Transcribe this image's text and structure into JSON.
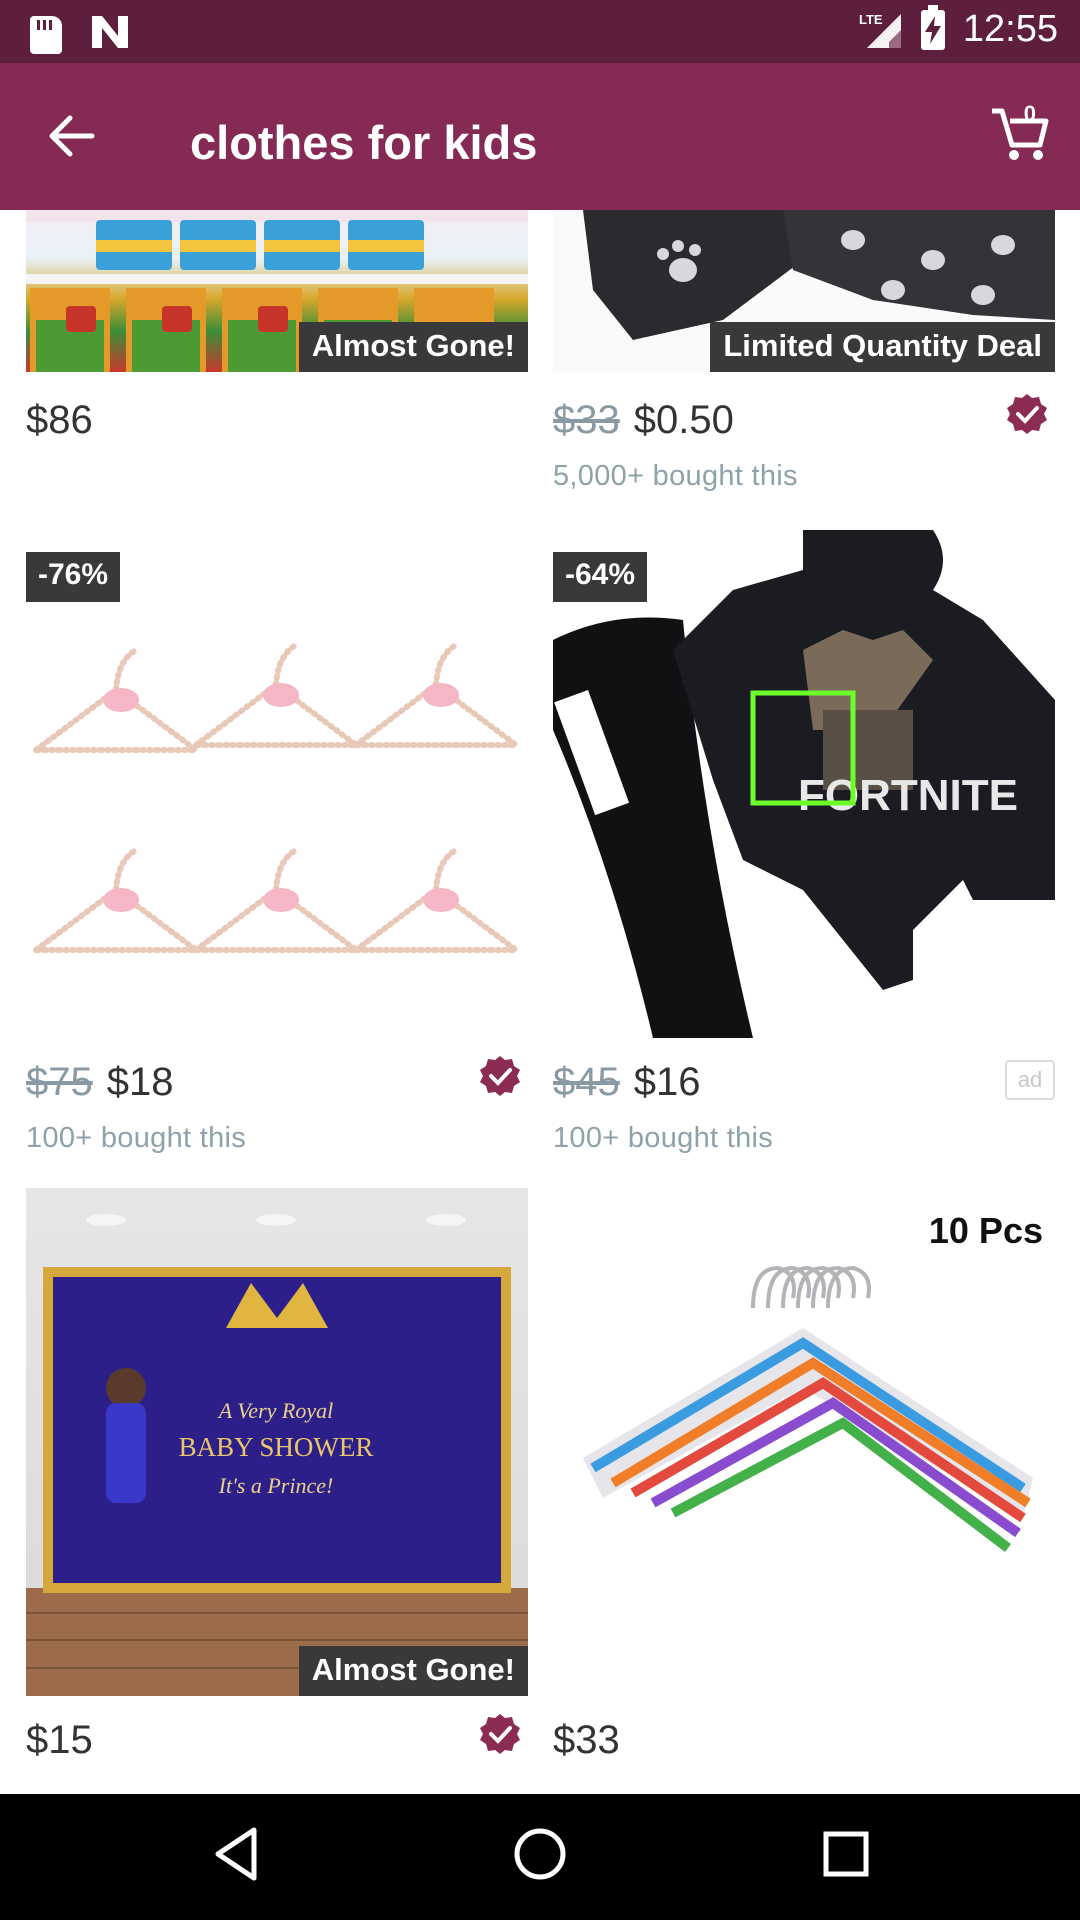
{
  "status_bar": {
    "time": "12:55",
    "icons": [
      "sd-card-icon",
      "n-notification-icon",
      "lte-signal-icon",
      "battery-charging-icon"
    ]
  },
  "app_bar": {
    "title": "clothes for kids",
    "cart_count": "0",
    "back_icon": "arrow-back-icon",
    "cart_icon": "shopping-cart-icon"
  },
  "colors": {
    "status_bar": "#5e1f3f",
    "app_bar": "#842a54",
    "verified_check": "#8a2c53",
    "banner_bg": "#39393b"
  },
  "products": [
    {
      "price": "$86",
      "original_price": "",
      "bought": "",
      "banner": "Almost Gone!",
      "discount": "",
      "verified": false,
      "ad": false,
      "image": "Winnie the Pooh party supplies"
    },
    {
      "price": "$0.50",
      "original_price": "$33",
      "bought": "5,000+ bought this",
      "banner": "Limited Quantity Deal",
      "discount": "",
      "verified": true,
      "ad": false,
      "image": "paw print scarf"
    },
    {
      "price": "$18",
      "original_price": "$75",
      "bought": "100+ bought this",
      "banner": "",
      "discount": "-76%",
      "verified": true,
      "ad": false,
      "image": "pearl bow kids hangers"
    },
    {
      "price": "$16",
      "original_price": "$45",
      "bought": "100+ bought this",
      "banner": "",
      "discount": "-64%",
      "verified": false,
      "ad": true,
      "image": "Fortnite hoodie and pants set"
    },
    {
      "price": "$15",
      "original_price": "",
      "bought": "",
      "banner": "Almost Gone!",
      "discount": "",
      "verified": true,
      "ad": false,
      "image": "royal baby shower backdrop"
    },
    {
      "price": "$33",
      "original_price": "",
      "bought": "",
      "banner": "",
      "discount": "",
      "verified": false,
      "ad": false,
      "image": "colorful plastic hangers",
      "corner_label": "10 Pcs"
    }
  ],
  "image_text": {
    "fortnite": "FORTNITE",
    "backdrop_line1": "A Very Royal",
    "backdrop_line2": "BABY SHOWER",
    "backdrop_line3": "It's a Prince!",
    "ad_label": "ad"
  },
  "nav_bar": {
    "back": "nav-back-icon",
    "home": "nav-home-icon",
    "recents": "nav-recents-icon"
  }
}
